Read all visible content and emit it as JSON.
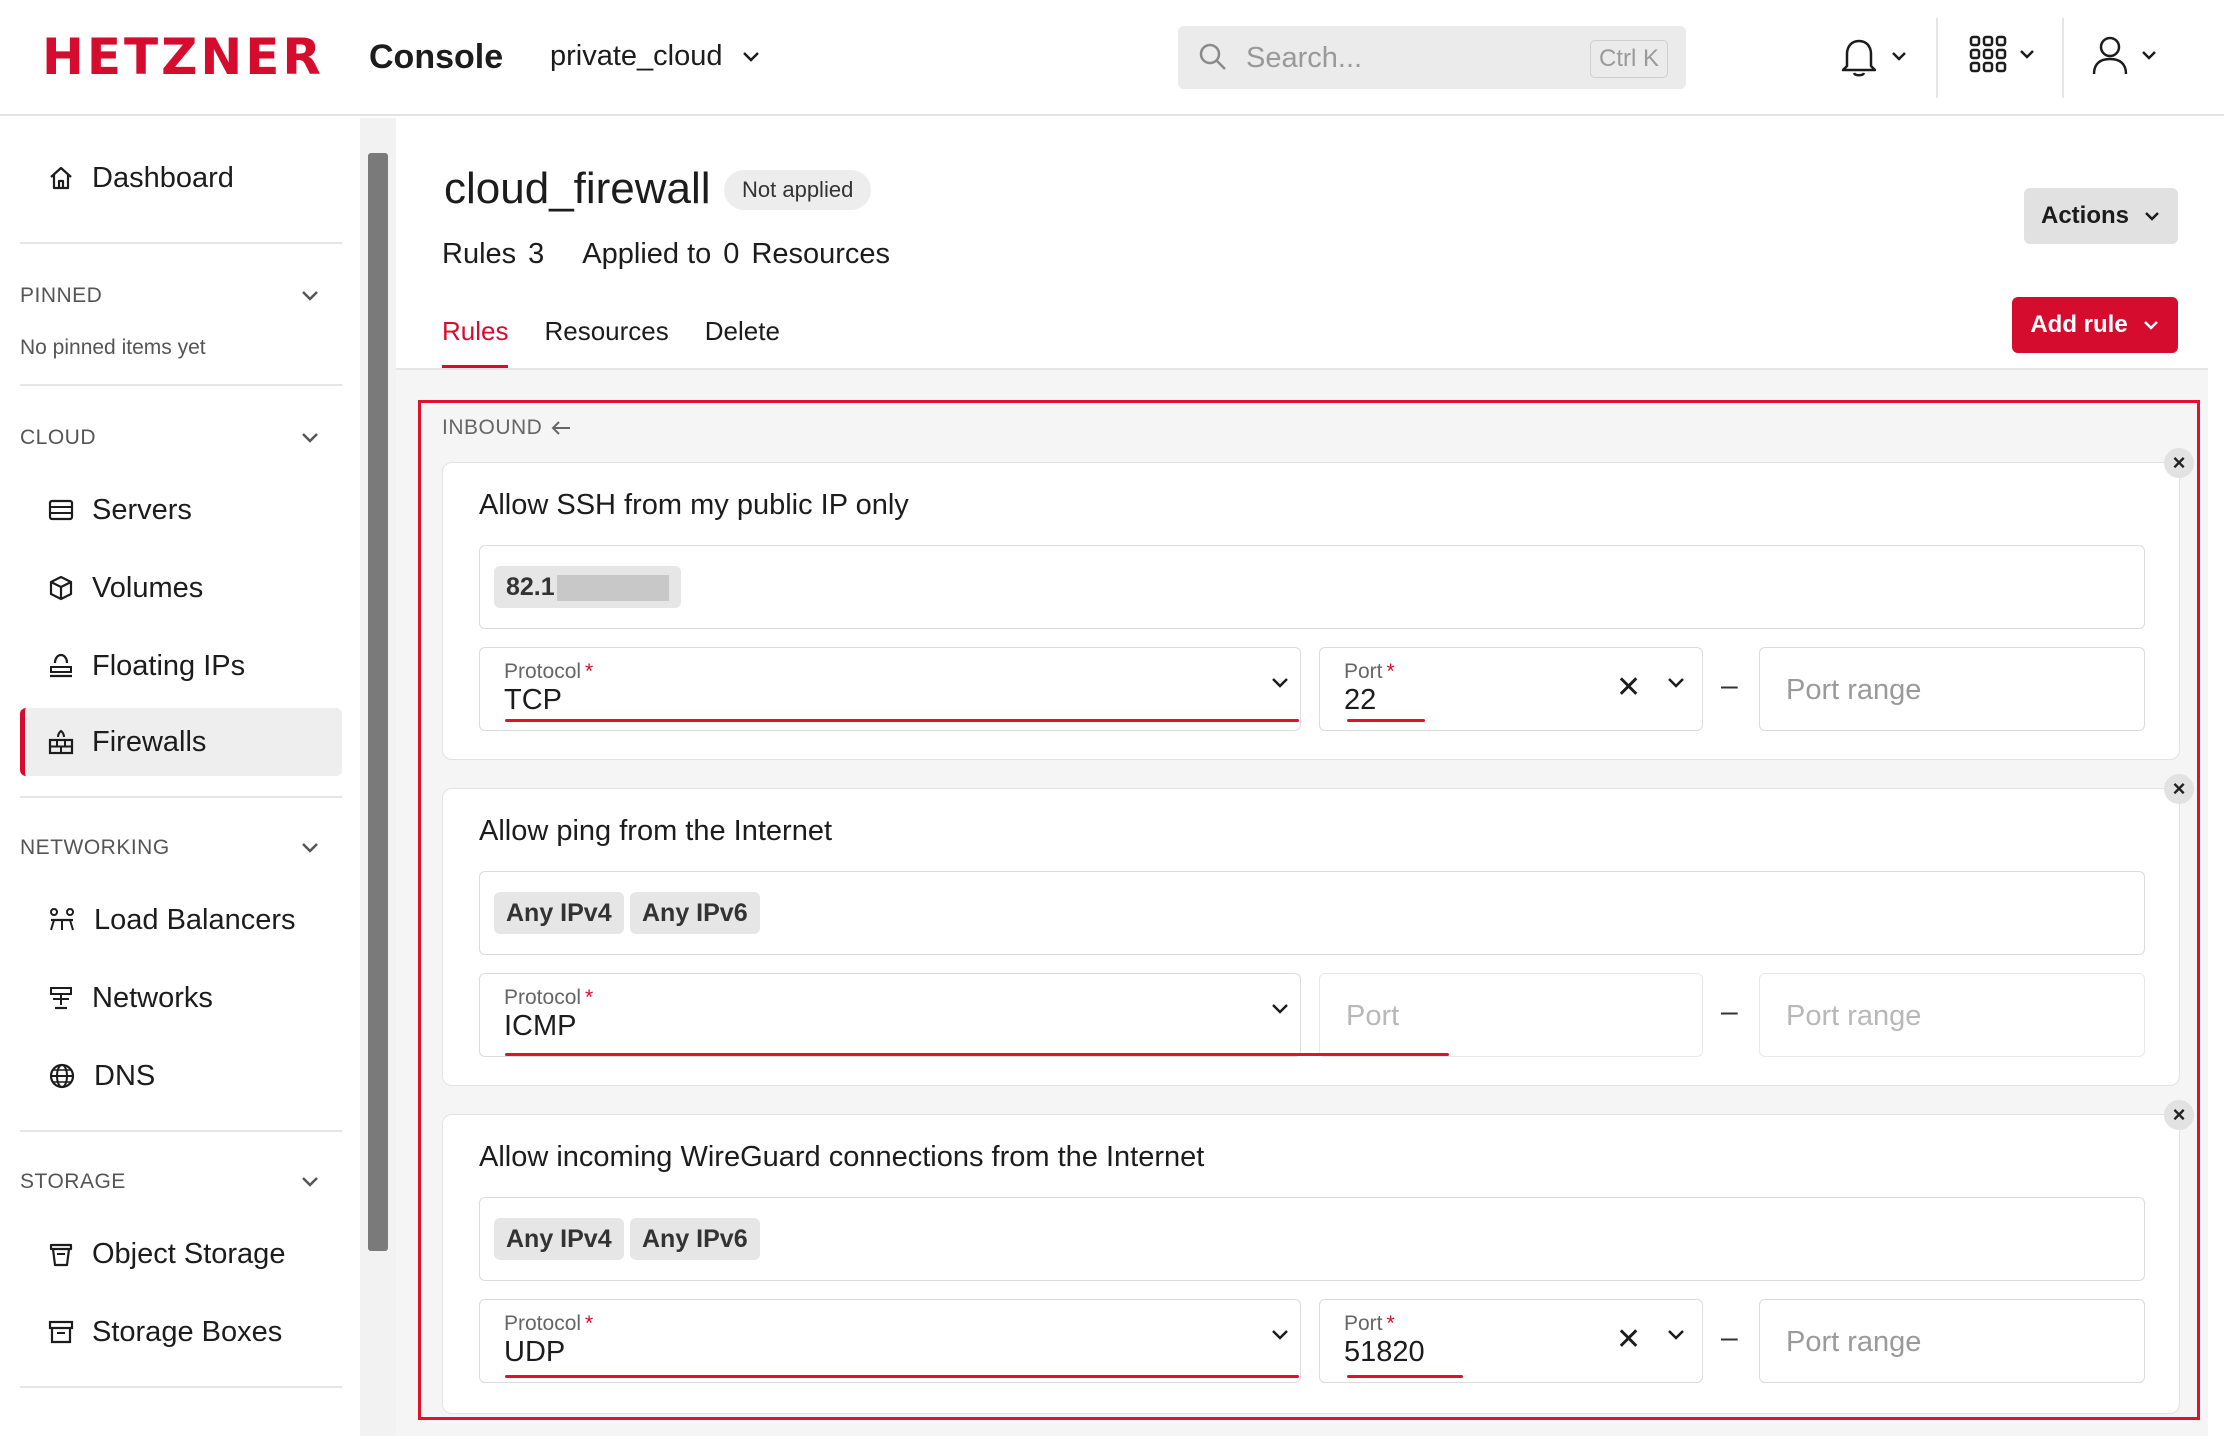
{
  "brand": {
    "logo": "HETZNER",
    "product": "Console",
    "accent": "#d50c2d"
  },
  "header": {
    "project": "private_cloud",
    "search": {
      "placeholder": "Search...",
      "shortcut": "Ctrl K"
    }
  },
  "sidebar": {
    "dashboard": "Dashboard",
    "pinned": {
      "heading": "PINNED",
      "empty": "No pinned items yet"
    },
    "cloud": {
      "heading": "CLOUD",
      "items": [
        "Servers",
        "Volumes",
        "Floating IPs",
        "Firewalls"
      ],
      "active": "Firewalls"
    },
    "networking": {
      "heading": "NETWORKING",
      "items": [
        "Load Balancers",
        "Networks",
        "DNS"
      ]
    },
    "storage": {
      "heading": "STORAGE",
      "items": [
        "Object Storage",
        "Storage Boxes"
      ]
    }
  },
  "page": {
    "title": "cloud_firewall",
    "status": "Not applied",
    "rules_label": "Rules",
    "rules_count": "3",
    "applied_label": "Applied to",
    "applied_count": "0",
    "applied_suffix": "Resources",
    "actions_label": "Actions",
    "add_rule_label": "Add rule",
    "tabs": [
      "Rules",
      "Resources",
      "Delete"
    ],
    "active_tab": "Rules"
  },
  "rules": {
    "direction_heading": "INBOUND",
    "items": [
      {
        "description": "Allow SSH from my public IP only",
        "sources": [
          "82.1"
        ],
        "protocol_label": "Protocol",
        "protocol": "TCP",
        "port_label": "Port",
        "port": "22",
        "port_range_placeholder": "Port range"
      },
      {
        "description": "Allow ping from the Internet",
        "sources": [
          "Any IPv4",
          "Any IPv6"
        ],
        "protocol_label": "Protocol",
        "protocol": "ICMP",
        "port_placeholder": "Port",
        "port_range_placeholder": "Port range"
      },
      {
        "description": "Allow incoming WireGuard connections from the Internet",
        "sources": [
          "Any IPv4",
          "Any IPv6"
        ],
        "protocol_label": "Protocol",
        "protocol": "UDP",
        "port_label": "Port",
        "port": "51820",
        "port_range_placeholder": "Port range"
      }
    ]
  },
  "icons": {
    "search": "search-icon",
    "bell": "bell-icon",
    "apps": "grid-icon",
    "user": "user-icon",
    "dashboard": "home-icon",
    "servers": "server-icon",
    "volumes": "cube-icon",
    "floating_ips": "floating-ip-icon",
    "firewalls": "firewall-icon",
    "load_balancers": "load-balancer-icon",
    "networks": "network-icon",
    "dns": "globe-icon",
    "object_storage": "bucket-icon",
    "storage_boxes": "archive-icon"
  }
}
